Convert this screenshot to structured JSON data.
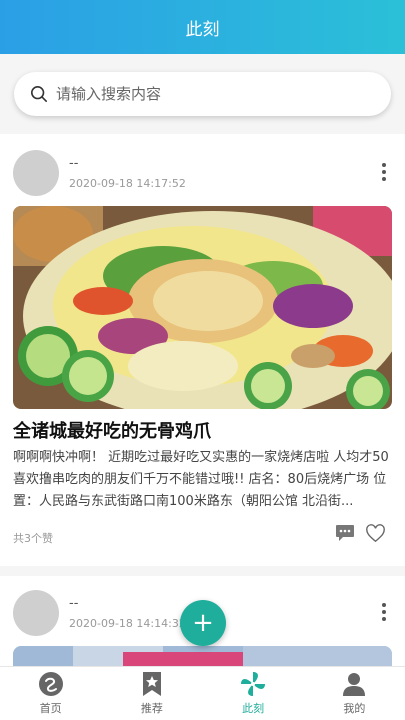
{
  "header": {
    "title": "此刻"
  },
  "search": {
    "placeholder": "请输入搜索内容"
  },
  "posts": [
    {
      "username": "--",
      "time": "2020-09-18 14:17:52",
      "title": "全诸城最好吃的无骨鸡爪",
      "body": "啊啊啊快冲啊！ 近期吃过最好吃又实惠的一家烧烤店啦 人均才50 喜欢撸串吃肉的朋友们千万不能错过哦!! 店名：80后烧烤广场 位置：人民路与东武街路口南100米路东（朝阳公馆 北沿街...",
      "likes": "共3个赞"
    },
    {
      "username": "--",
      "time": "2020-09-18 14:14:32"
    }
  ],
  "fab": {
    "label": "+"
  },
  "tabs": [
    {
      "label": "首页",
      "icon": "home-icon"
    },
    {
      "label": "推荐",
      "icon": "bookmark-star-icon"
    },
    {
      "label": "此刻",
      "icon": "pinwheel-icon"
    },
    {
      "label": "我的",
      "icon": "person-icon"
    }
  ],
  "colors": {
    "accent": "#1fae9b",
    "header_start": "#2b9fe6",
    "header_end": "#2bc0d8"
  }
}
